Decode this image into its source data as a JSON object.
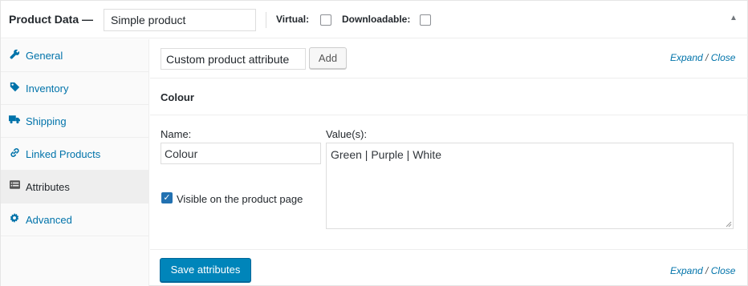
{
  "header": {
    "title": "Product Data —",
    "product_type": "Simple product",
    "virtual_label": "Virtual:",
    "virtual_checked": false,
    "downloadable_label": "Downloadable:",
    "downloadable_checked": false,
    "toggle_icon": "triangle-up-icon"
  },
  "sidebar": {
    "items": [
      {
        "label": "General",
        "icon": "wrench-icon",
        "active": false
      },
      {
        "label": "Inventory",
        "icon": "tag-icon",
        "active": false
      },
      {
        "label": "Shipping",
        "icon": "truck-icon",
        "active": false
      },
      {
        "label": "Linked Products",
        "icon": "link-icon",
        "active": false
      },
      {
        "label": "Attributes",
        "icon": "list-icon",
        "active": true
      },
      {
        "label": "Advanced",
        "icon": "gear-icon",
        "active": false
      }
    ]
  },
  "toolbar": {
    "attribute_select": "Custom product attribute",
    "add_label": "Add",
    "expand_label": "Expand",
    "close_label": "Close",
    "separator": "/"
  },
  "attribute": {
    "heading": "Colour",
    "name_label": "Name:",
    "name_value": "Colour",
    "values_label": "Value(s):",
    "values_value": "Green | Purple | White",
    "visible_label": "Visible on the product page",
    "visible_checked": true
  },
  "footer": {
    "save_label": "Save attributes",
    "expand_label": "Expand",
    "close_label": "Close",
    "separator": "/"
  },
  "colors": {
    "link": "#0073aa",
    "primary_button": "#0085ba",
    "active_tab_bg": "#eeeeee"
  }
}
